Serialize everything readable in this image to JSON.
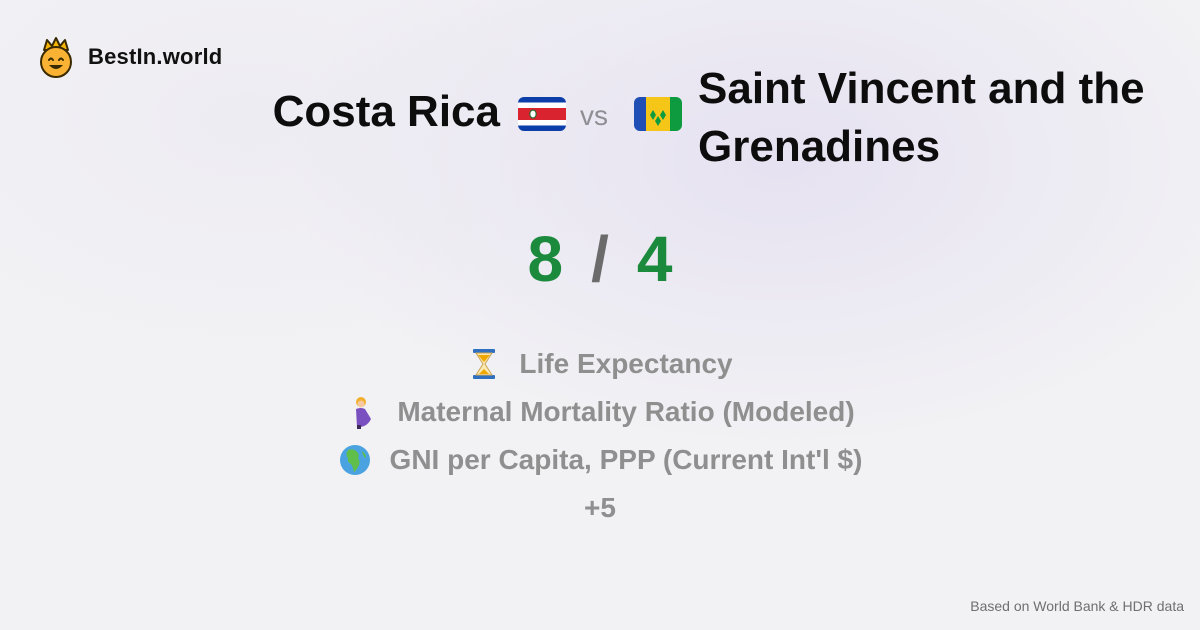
{
  "brand": {
    "name": "BestIn.world",
    "icon": "crowned-smiley-icon"
  },
  "comparison": {
    "country_a": "Costa Rica",
    "country_b": "Saint Vincent and the Grenadines",
    "vs_label": "vs",
    "flag_a": "costa-rica-flag-icon",
    "flag_b": "saint-vincent-flag-icon"
  },
  "score": {
    "a": "8",
    "separator": "/",
    "b": "4",
    "color": "#1b8a3d"
  },
  "metrics": [
    {
      "icon": "hourglass-icon",
      "label": "Life Expectancy"
    },
    {
      "icon": "pregnant-woman-icon",
      "label": "Maternal Mortality Ratio (Modeled)"
    },
    {
      "icon": "globe-africa-icon",
      "label": "GNI per Capita, PPP (Current Int'l $)"
    }
  ],
  "more_label": "+5",
  "footer": "Based on World Bank & HDR data"
}
